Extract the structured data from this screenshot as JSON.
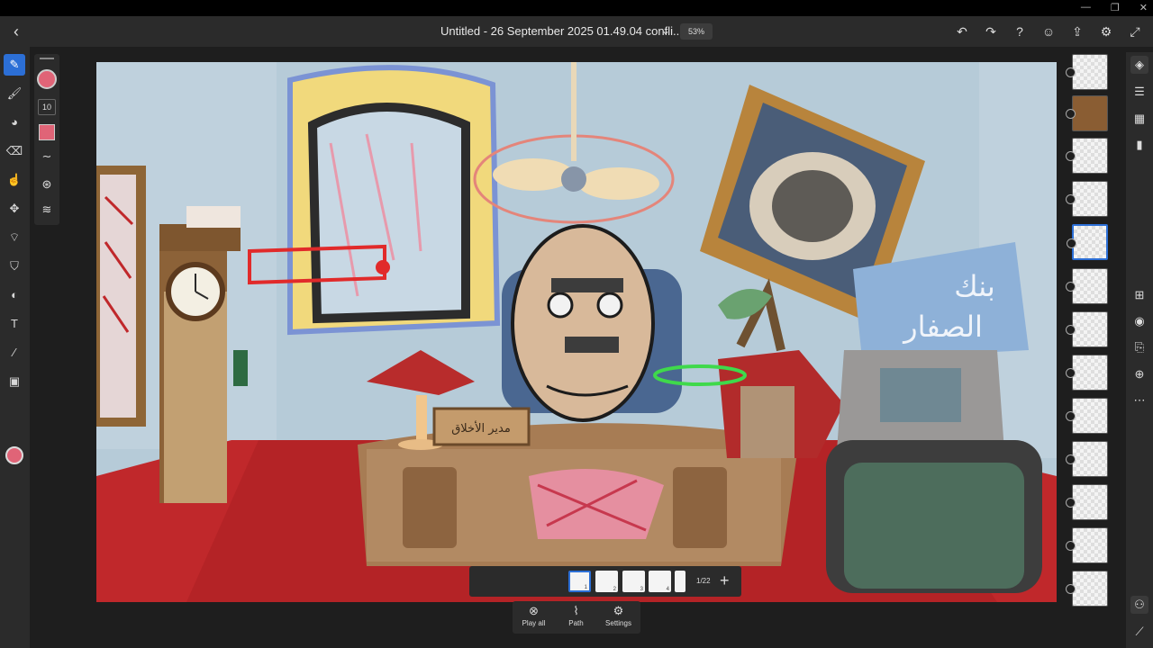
{
  "window": {
    "minimize": "—",
    "maximize": "❐",
    "close": "✕"
  },
  "topbar": {
    "back_icon": "‹",
    "title": "Untitled - 26 September 2025 01.49.04 confli...*",
    "title_chevron": "⌄",
    "zoom": "53%",
    "icons": {
      "undo": "↶",
      "redo": "↷",
      "help": "?",
      "account": "☺",
      "share": "⇪",
      "settings": "⚙",
      "fullscreen": "⤢"
    }
  },
  "left_tools": [
    {
      "name": "pencil-tool",
      "glyph": "✎",
      "active": true
    },
    {
      "name": "paint-brush-tool",
      "glyph": "🖌",
      "active": false
    },
    {
      "name": "fill-brush-tool",
      "glyph": "◕",
      "active": false
    },
    {
      "name": "eraser-tool",
      "glyph": "⌫",
      "active": false
    },
    {
      "name": "smudge-tool",
      "glyph": "☝",
      "active": false
    },
    {
      "name": "move-tool",
      "glyph": "✥",
      "active": false
    },
    {
      "name": "lasso-tool",
      "glyph": "⌔",
      "active": false
    },
    {
      "name": "paint-bucket-tool",
      "glyph": "⛉",
      "active": false
    },
    {
      "name": "blend-tool",
      "glyph": "◐",
      "active": false
    },
    {
      "name": "text-tool",
      "glyph": "T",
      "active": false
    },
    {
      "name": "eyedropper-tool",
      "glyph": "⁄",
      "active": false
    },
    {
      "name": "image-tool",
      "glyph": "▣",
      "active": false
    }
  ],
  "context_bar": {
    "brush_size": "10",
    "color": "#e06477",
    "icons": {
      "stroke": "∼",
      "stabilizer": "⊛",
      "settings": "≋"
    }
  },
  "timeline": {
    "frames": [
      "1",
      "2",
      "3",
      "4"
    ],
    "counter": "1/22",
    "add_icon": "+"
  },
  "bottom_bar": {
    "play_all": {
      "icon": "⊗",
      "label": "Play all"
    },
    "path": {
      "icon": "⌇",
      "label": "Path"
    },
    "settings": {
      "icon": "⚙",
      "label": "Settings"
    }
  },
  "right_icons": {
    "layers": "◈",
    "adjustments": "☰",
    "grid": "▦",
    "comments": "▮",
    "add": "⊞",
    "visibility": "◉",
    "import": "⎘",
    "effects": "⊕",
    "more": "⋯",
    "onion": "⚇",
    "ruler": "⟋"
  },
  "canvas_text": {
    "desk_plaque": "مدير الأخلاق",
    "bank_sign_line1": "بنك",
    "bank_sign_line2": "الصفار"
  }
}
